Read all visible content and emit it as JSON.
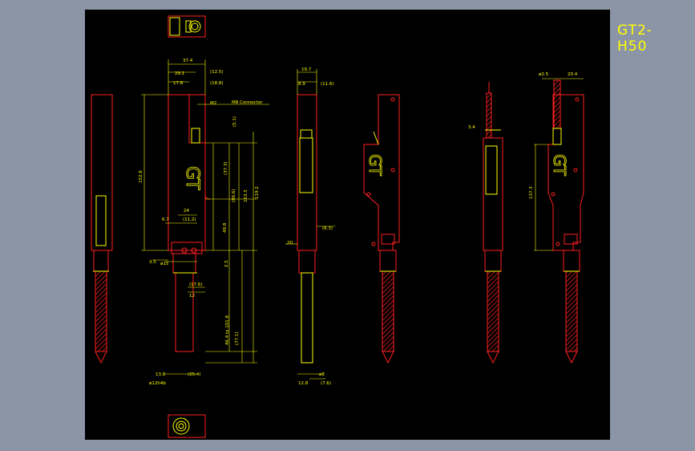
{
  "drawing": {
    "title": "GT2-H50",
    "connector_note": "M8 Connector",
    "colors": {
      "background": "#000000",
      "frame": "#8c95a6",
      "outline": "#ff2020",
      "dimension": "#ffff00",
      "hatch": "#ff2020",
      "text": "#ffff00"
    },
    "dims": {
      "d1": "37.4",
      "d2": "29.1",
      "d3": "(12.5)",
      "d4": "17.8",
      "d5": "(18.8)",
      "d6": "(5.1)",
      "d7": "(37.3)",
      "d8": "(86.6)",
      "d9": "152.6",
      "d10": "163.5",
      "d11": "119.2",
      "d12": "24",
      "d13": "6.7",
      "d14": "(11.2)",
      "d15": "49.8",
      "d16": "3.5",
      "d17": "(17.6)",
      "d18": "46.4 to 101.8",
      "d19": "(77.1)",
      "d20": "13.8",
      "d21": "(25.4)",
      "d22": "2.5",
      "d23": "12",
      "d24": "19.7",
      "d25": "8.9",
      "d26": "(11.6)",
      "d27": "(6.3)",
      "d28": "20",
      "d29": "ø8",
      "d30": "12.8",
      "d31": "(7.6)",
      "d32": "ø2.5",
      "d33": "20.4",
      "d34": "3.4",
      "d35": "137.3",
      "d36": "M2",
      "d37": "152.6",
      "d38": "ø15",
      "d39": "ø12h4b"
    },
    "logo_text": "GT"
  }
}
